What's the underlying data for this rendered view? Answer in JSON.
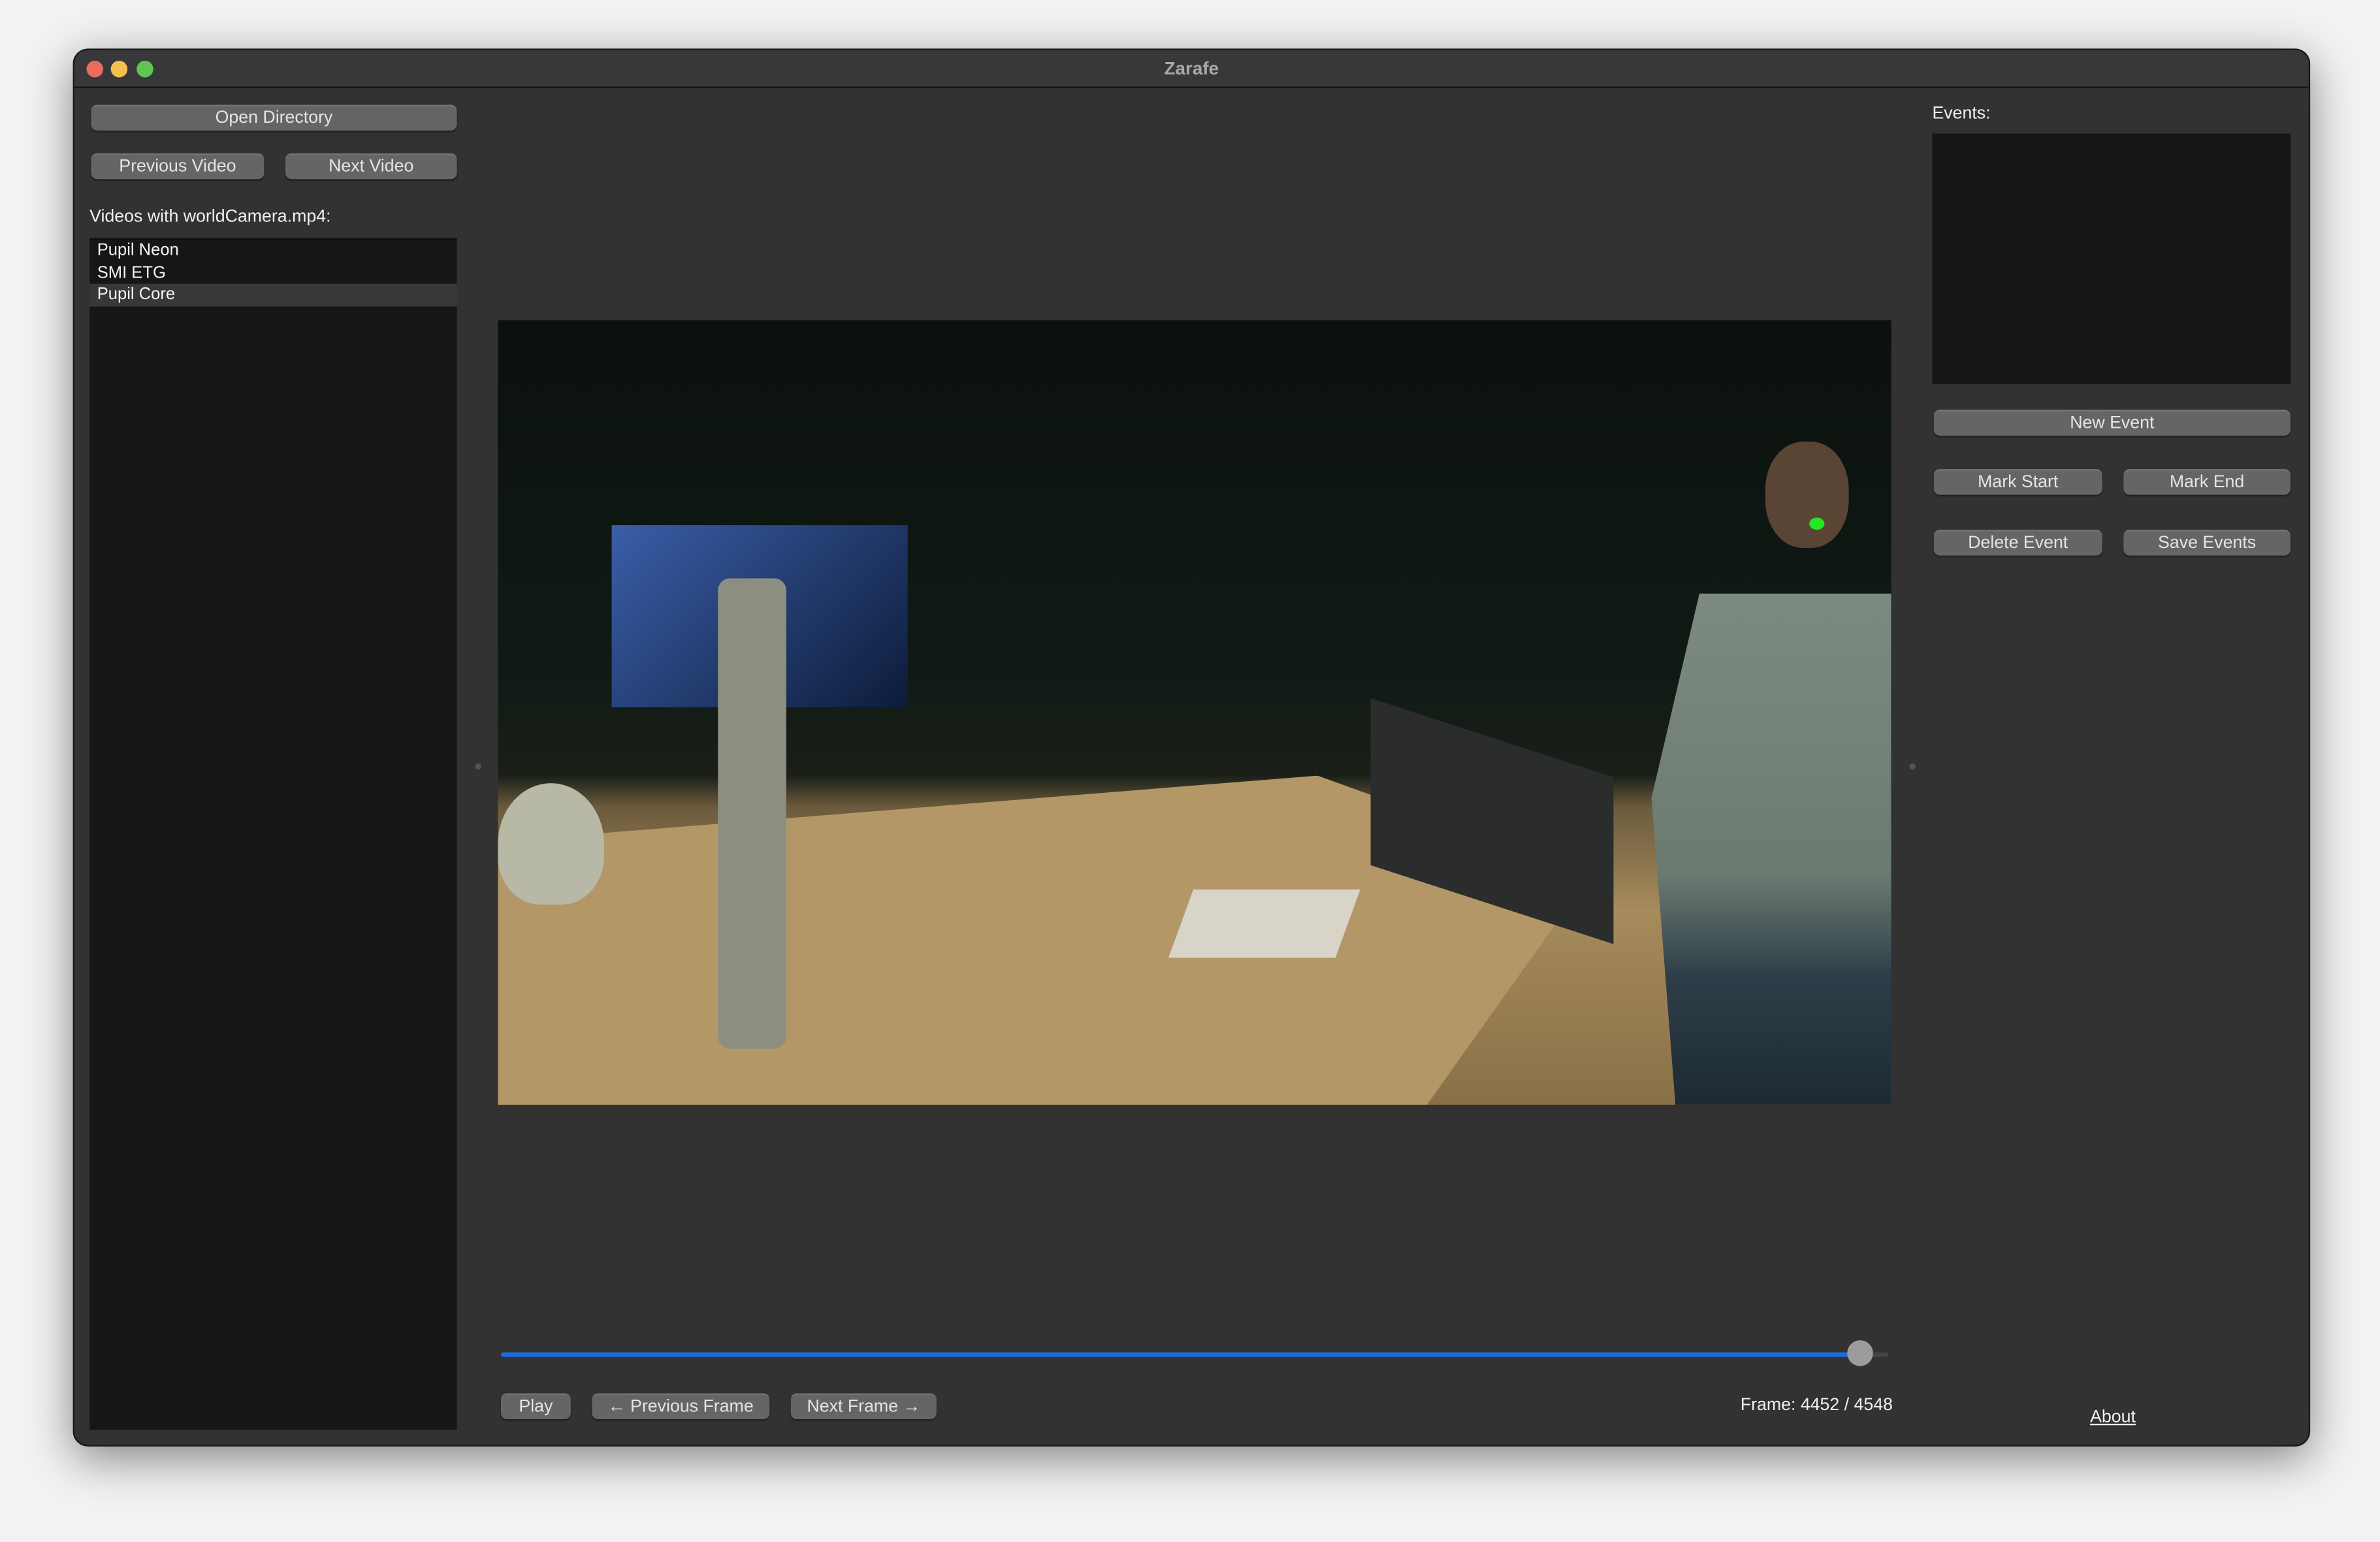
{
  "window": {
    "title": "Zarafe"
  },
  "left_panel": {
    "open_directory": "Open Directory",
    "previous_video": "Previous Video",
    "next_video": "Next Video",
    "videos_label": "Videos with worldCamera.mp4:",
    "videos": [
      {
        "label": "Pupil Neon",
        "selected": false
      },
      {
        "label": "SMI ETG",
        "selected": false
      },
      {
        "label": "Pupil Core",
        "selected": true
      }
    ]
  },
  "player": {
    "play": "Play",
    "previous_frame": "← Previous Frame",
    "next_frame": "Next Frame →",
    "frame_label": "Frame: 4452 / 4548",
    "current_frame": 4452,
    "total_frames": 4548,
    "accent_color": "#1e6be0",
    "gaze_marker_color": "#22e822"
  },
  "right_panel": {
    "events_label": "Events:",
    "events": [],
    "new_event": "New Event",
    "mark_start": "Mark Start",
    "mark_end": "Mark End",
    "delete_event": "Delete Event",
    "save_events": "Save Events",
    "about": "About"
  }
}
